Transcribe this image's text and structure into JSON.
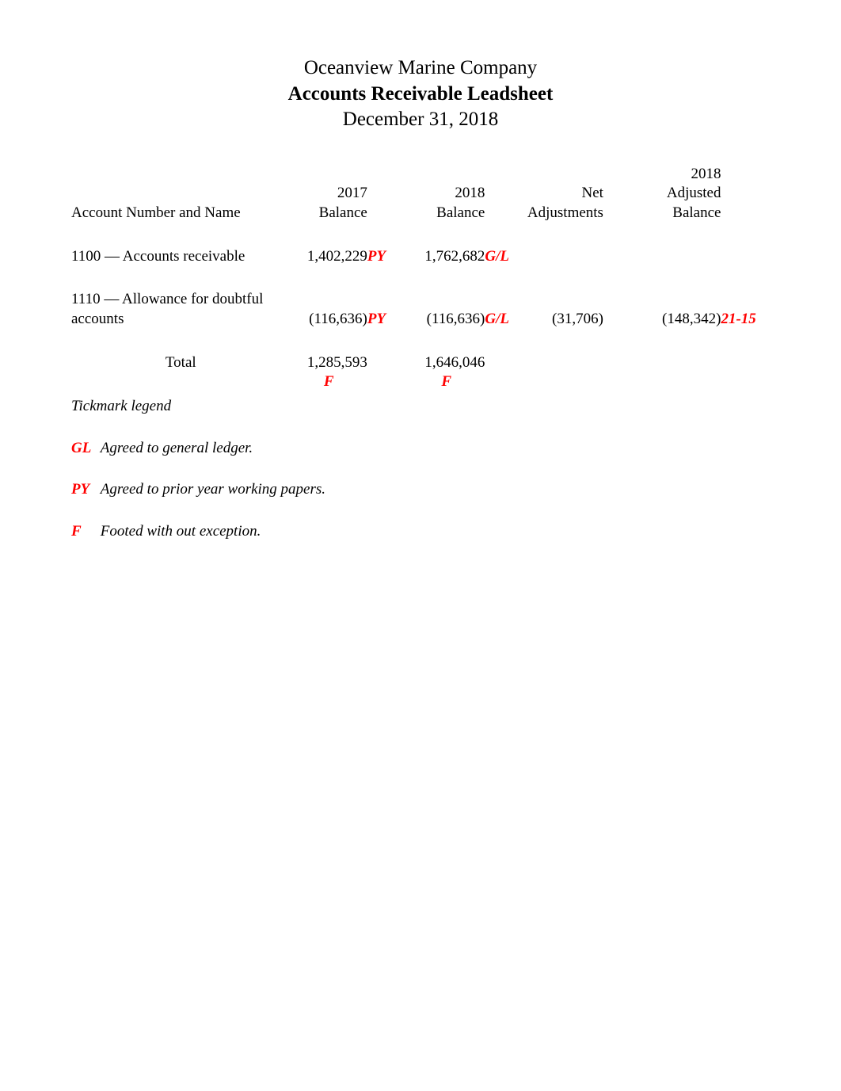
{
  "header": {
    "company": "Oceanview Marine Company",
    "title": "Accounts Receivable Leadsheet",
    "date": "December 31, 2018"
  },
  "columns": {
    "name": "Account Number and Name",
    "c2017_l1": "2017",
    "c2017_l2": "Balance",
    "c2018_l1": "2018",
    "c2018_l2": "Balance",
    "adj_l1": "Net",
    "adj_l2": "Adjustments",
    "adjbal_l1": "2018",
    "adjbal_l2": "Adjusted",
    "adjbal_l3": "Balance"
  },
  "rows": [
    {
      "name": "1100 — Accounts receivable",
      "b2017": "1,402,229",
      "tm2017": "PY",
      "b2018": "1,762,682",
      "tm2018": "G/L",
      "adj": "",
      "adjBal": "",
      "ref": ""
    },
    {
      "name": "1110 — Allowance for   doubtful accounts",
      "b2017": "(116,636)",
      "tm2017": "PY",
      "b2018": "(116,636)",
      "tm2018": "G/L",
      "adj": "(31,706)",
      "adjBal": "(148,342)",
      "ref": "21-15"
    }
  ],
  "total": {
    "label": "Total",
    "b2017": "1,285,593",
    "tm2017": "F",
    "b2018": "1,646,046",
    "tm2018": "F"
  },
  "legend": {
    "title": "Tickmark legend",
    "items": [
      {
        "code": "GL",
        "desc": "Agreed to general ledger."
      },
      {
        "code": "PY",
        "desc": "Agreed to prior year working papers."
      },
      {
        "code": "F",
        "desc": "Footed with out exception."
      }
    ]
  }
}
